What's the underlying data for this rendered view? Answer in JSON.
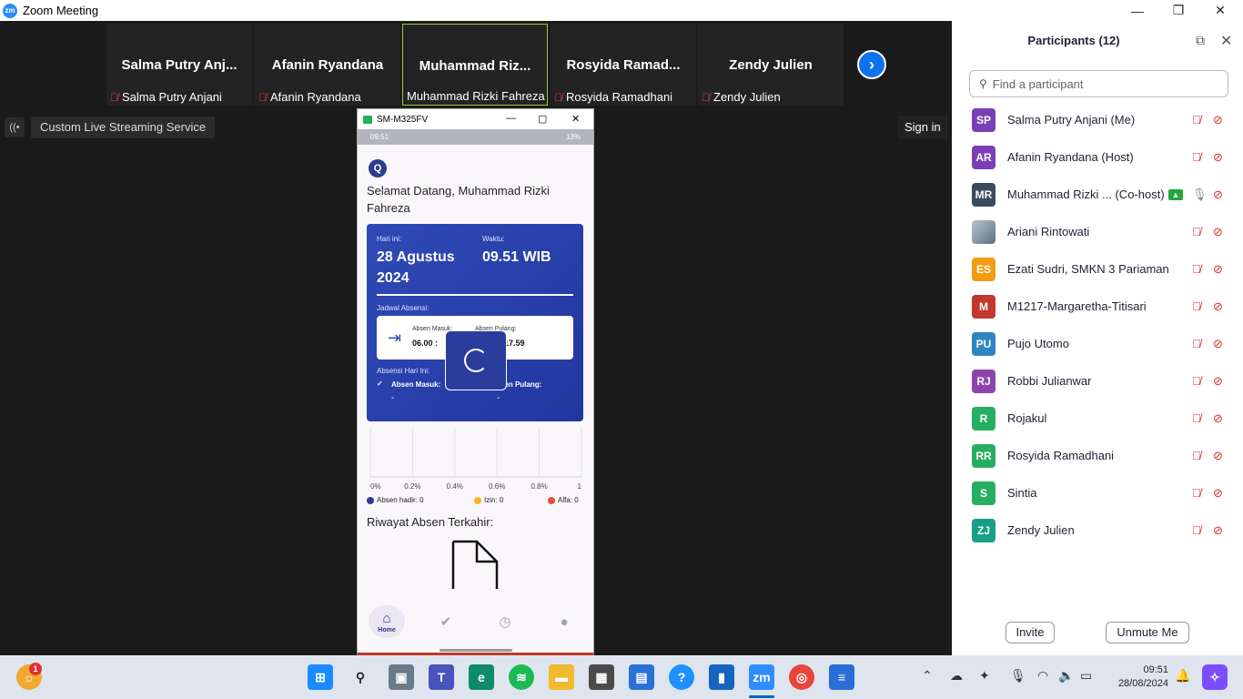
{
  "window": {
    "title": "Zoom Meeting",
    "minimize": "—",
    "maximize": "❐",
    "close": "✕"
  },
  "tiles": [
    {
      "big": "Salma  Putry  Anj...",
      "small": "Salma Putry Anjani",
      "muted": true,
      "active": false
    },
    {
      "big": "Afanin Ryandana",
      "small": "Afanin Ryandana",
      "muted": true,
      "active": false
    },
    {
      "big": "Muhammad  Riz...",
      "small": "Muhammad Rizki Fahreza",
      "muted": false,
      "active": true
    },
    {
      "big": "Rosyida  Ramad...",
      "small": "Rosyida Ramadhani",
      "muted": true,
      "active": false
    },
    {
      "big": "Zendy Julien",
      "small": "Zendy Julien",
      "muted": true,
      "active": false
    }
  ],
  "live_streaming_label": "Custom Live Streaming Service",
  "sign_in": "Sign in",
  "phone": {
    "window_title": "SM-M325FV",
    "status_time": "09:51",
    "status_battery": "13%",
    "welcome": "Selamat Datang, Muhammad Rizki Fahreza",
    "today_label": "Hari ini:",
    "today_value": "28 Agustus 2024",
    "time_label": "Waktu:",
    "time_value": "09.51 WIB",
    "schedule_label": "Jadwal Absensi:",
    "absen_masuk_label": "Absen Masuk:",
    "absen_masuk_value": "06.00 :",
    "absen_pulang_label": "Absen Pulang:",
    "absen_pulang_value": "17.59",
    "today_attendance_label": "Absensi Hari Ini:",
    "att_masuk": "Absen Masuk:",
    "att_masuk_value": "-",
    "att_pulang": "sen Pulang:",
    "att_pulang_value": "-",
    "history_title": "Riwayat Absen Terkahir:",
    "nav_home": "Home",
    "legend": [
      {
        "label": "Absen hadir: 0",
        "color": "#2e3b8f"
      },
      {
        "label": "Izin: 0",
        "color": "#f5b820"
      },
      {
        "label": "Alfa: 0",
        "color": "#e74c3c"
      }
    ]
  },
  "chart_data": {
    "type": "bar",
    "categories": [
      "Absen hadir",
      "Izin",
      "Alfa"
    ],
    "values": [
      0,
      0,
      0
    ],
    "xticks": [
      "0%",
      "0.2%",
      "0.4%",
      "0.6%",
      "0.8%",
      "1"
    ],
    "xlim": [
      0,
      1
    ]
  },
  "participants": {
    "title": "Participants (12)",
    "search_placeholder": "Find a participant",
    "list": [
      {
        "initials": "SP",
        "name": "Salma Putry Anjani (Me)",
        "color": "#7b3fb5",
        "mic_on": false,
        "sharing": false
      },
      {
        "initials": "AR",
        "name": "Afanin Ryandana (Host)",
        "color": "#7b3fb5",
        "mic_on": false,
        "sharing": false
      },
      {
        "initials": "MR",
        "name": "Muhammad Rizki ...  (Co-host)",
        "color": "#3a4a5c",
        "mic_on": true,
        "sharing": true
      },
      {
        "initials": "",
        "name": "Ariani Rintowati",
        "color": "#8a9aa8",
        "mic_on": false,
        "sharing": false
      },
      {
        "initials": "ES",
        "name": "Ezati Sudri, SMKN 3 Pariaman",
        "color": "#f39c12",
        "mic_on": false,
        "sharing": false
      },
      {
        "initials": "M",
        "name": "M1217-Margaretha-Titisari",
        "color": "#c0392b",
        "mic_on": false,
        "sharing": false
      },
      {
        "initials": "PU",
        "name": "Pujo Utomo",
        "color": "#2e86c1",
        "mic_on": false,
        "sharing": false
      },
      {
        "initials": "RJ",
        "name": "Robbi Julianwar",
        "color": "#8e44ad",
        "mic_on": false,
        "sharing": false
      },
      {
        "initials": "R",
        "name": "Rojakul",
        "color": "#27ae60",
        "mic_on": false,
        "sharing": false
      },
      {
        "initials": "RR",
        "name": "Rosyida Ramadhani",
        "color": "#27ae60",
        "mic_on": false,
        "sharing": false
      },
      {
        "initials": "S",
        "name": "Sintia",
        "color": "#27ae60",
        "mic_on": false,
        "sharing": false
      },
      {
        "initials": "ZJ",
        "name": "Zendy Julien",
        "color": "#16a085",
        "mic_on": false,
        "sharing": false
      }
    ],
    "invite": "Invite",
    "unmute_me": "Unmute Me"
  },
  "taskbar": {
    "time": "09:51",
    "date": "28/08/2024",
    "weather_badge": "1",
    "zoom_label": "zm"
  }
}
